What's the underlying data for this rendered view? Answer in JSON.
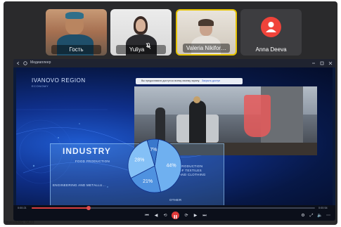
{
  "participants": [
    {
      "name": "Гость",
      "muted": false
    },
    {
      "name": "Yuliya",
      "muted": true
    },
    {
      "name": "Valeria Nikifor…",
      "muted": false,
      "active": true
    },
    {
      "name": "Anna Deeva",
      "muted": false,
      "avatar_color": "#f0433a"
    }
  ],
  "window": {
    "title": "Медиаплеер"
  },
  "slide": {
    "region": "IVANOVO REGION",
    "region_sub": "ECONOMY",
    "notice": "Вы предоставили доступ ко всему своему экрану.",
    "notice_link": "Закрыть доступ",
    "heading": "INDUSTRY",
    "chart_data": {
      "type": "pie",
      "values": [
        44,
        21,
        28,
        7
      ],
      "value_labels": [
        "44%",
        "21%",
        "28%",
        "7%"
      ],
      "slice_labels": [
        "PRODUCTION OF TEXTILES AND CLOTHING",
        "OTHER",
        "ENGINEERING AND METALLU…",
        "FOOD PRODUCTION"
      ],
      "colors": [
        "#6fb0f0",
        "#4f92e0",
        "#84c0f6",
        "#3a78cc"
      ]
    },
    "labels": {
      "food": "FOOD PRODUCTION",
      "eng": "ENGINEERING AND METALLU…",
      "prod1": "PRODUCTION",
      "prod2": "OF TEXTILES",
      "prod3": "AND CLOTHING",
      "other": "OTHER"
    }
  },
  "player": {
    "time_elapsed": "0:00:21",
    "time_total": "0:00:54",
    "progress": 0.2,
    "file_name": "InvestENG_04.23"
  }
}
